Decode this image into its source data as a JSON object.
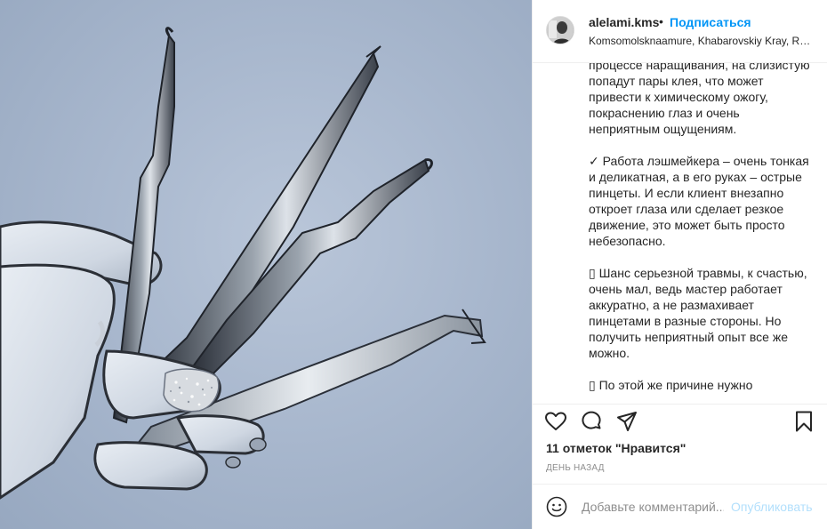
{
  "post": {
    "username": "alelami.kms",
    "separator": "•",
    "follow_label": "Подписаться",
    "location": "Komsomolsknaamure, Khabarovskiy Kray, Russia",
    "caption_paragraphs": [
      "процессе наращивания, на слизистую попадут пары клея, что может привести к химическому ожогу, покраснению глаз и очень неприятным ощущениям.",
      "✓ Работа лэшмейкера – очень тонкая и деликатная, а в его руках – острые пинцеты. И если клиент внезапно откроет глаза или сделает резкое движение, это может быть просто небезопасно.",
      "▯ Шанс серьезной травмы, к счастью, очень мал, ведь мастер работает аккуратно, а не размахивает пинцетами в разные стороны. Но получить неприятный опыт все же можно.",
      "▯ По этой же причине нужно"
    ],
    "likes_text": "11 отметок \"Нравится\"",
    "time_text": "день назад"
  },
  "comment": {
    "placeholder": "Добавьте комментарий...",
    "publish_label": "Опубликовать"
  },
  "icons": {
    "like": "heart-icon",
    "comment": "comment-bubble-icon",
    "share": "paper-plane-icon",
    "save": "bookmark-icon",
    "emoji": "smiley-icon"
  },
  "colors": {
    "follow_blue": "#0095f6",
    "publish_disabled": "#b2dffc",
    "muted_text": "#8e8e8e",
    "divider": "#efefef"
  }
}
